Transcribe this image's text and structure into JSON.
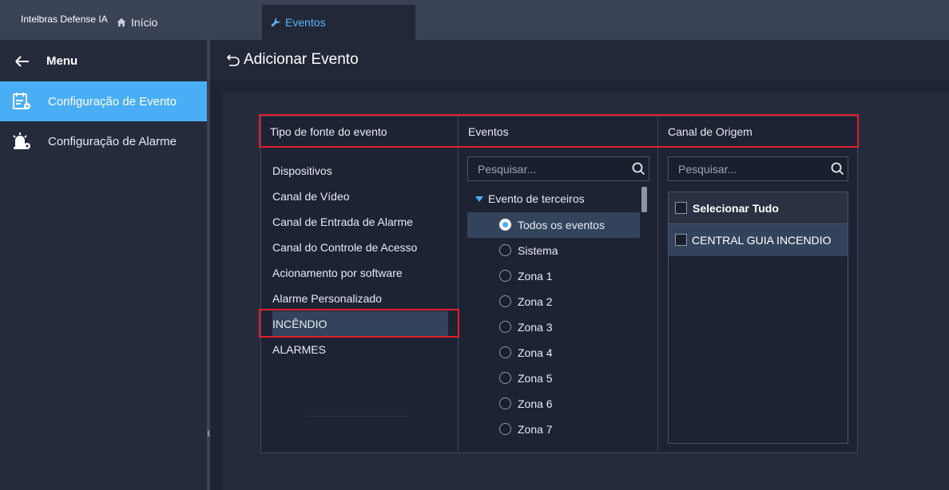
{
  "topbar": {
    "brand": "Intelbras Defense IA",
    "home_tab": "Início",
    "events_tab": "Eventos"
  },
  "sidebar": {
    "menu_label": "Menu",
    "items": [
      {
        "label": "Configuração de Evento",
        "active": true
      },
      {
        "label": "Configuração de Alarme",
        "active": false
      }
    ]
  },
  "page": {
    "title": "Adicionar Evento"
  },
  "columns": {
    "source_type": "Tipo de fonte do evento",
    "events": "Eventos",
    "origin_channel": "Canal de Origem"
  },
  "source_types": [
    "Dispositivos",
    "Canal de Vídeo",
    "Canal de Entrada de Alarme",
    "Canal do Controle de Acesso",
    "Acionamento por software",
    "Alarme Personalizado",
    "INCÊNDIO",
    "ALARMES"
  ],
  "selected_source": "INCÊNDIO",
  "events_search": {
    "placeholder": "Pesquisar..."
  },
  "events_tree": {
    "parent": "Evento de terceiros",
    "items": [
      {
        "label": "Todos os eventos",
        "selected": true
      },
      {
        "label": "Sistema",
        "selected": false
      },
      {
        "label": "Zona 1",
        "selected": false
      },
      {
        "label": "Zona 2",
        "selected": false
      },
      {
        "label": "Zona 3",
        "selected": false
      },
      {
        "label": "Zona 4",
        "selected": false
      },
      {
        "label": "Zona 5",
        "selected": false
      },
      {
        "label": "Zona 6",
        "selected": false
      },
      {
        "label": "Zona 7",
        "selected": false
      }
    ]
  },
  "origin_search": {
    "placeholder": "Pesquisar..."
  },
  "origin": {
    "select_all": "Selecionar Tudo",
    "rows": [
      "CENTRAL GUIA INCENDIO"
    ]
  },
  "colors": {
    "accent": "#4aaef6",
    "highlight_box": "#e0202a",
    "selected_row": "#34435c"
  }
}
